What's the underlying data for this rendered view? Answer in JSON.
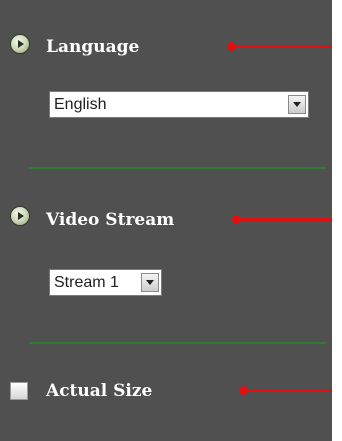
{
  "language_section": {
    "title": "Language",
    "selected": "English"
  },
  "video_stream_section": {
    "title": "Video Stream",
    "selected": "Stream 1"
  },
  "actual_size_section": {
    "title": "Actual Size",
    "checked": false
  },
  "colors": {
    "panel_background": "#505050",
    "divider": "#2e7d2e",
    "pointer_arrow": "#e01010",
    "title_text": "#ffffff"
  },
  "icons": [
    "expand-arrow-icon",
    "chevron-down-icon",
    "checkbox"
  ]
}
